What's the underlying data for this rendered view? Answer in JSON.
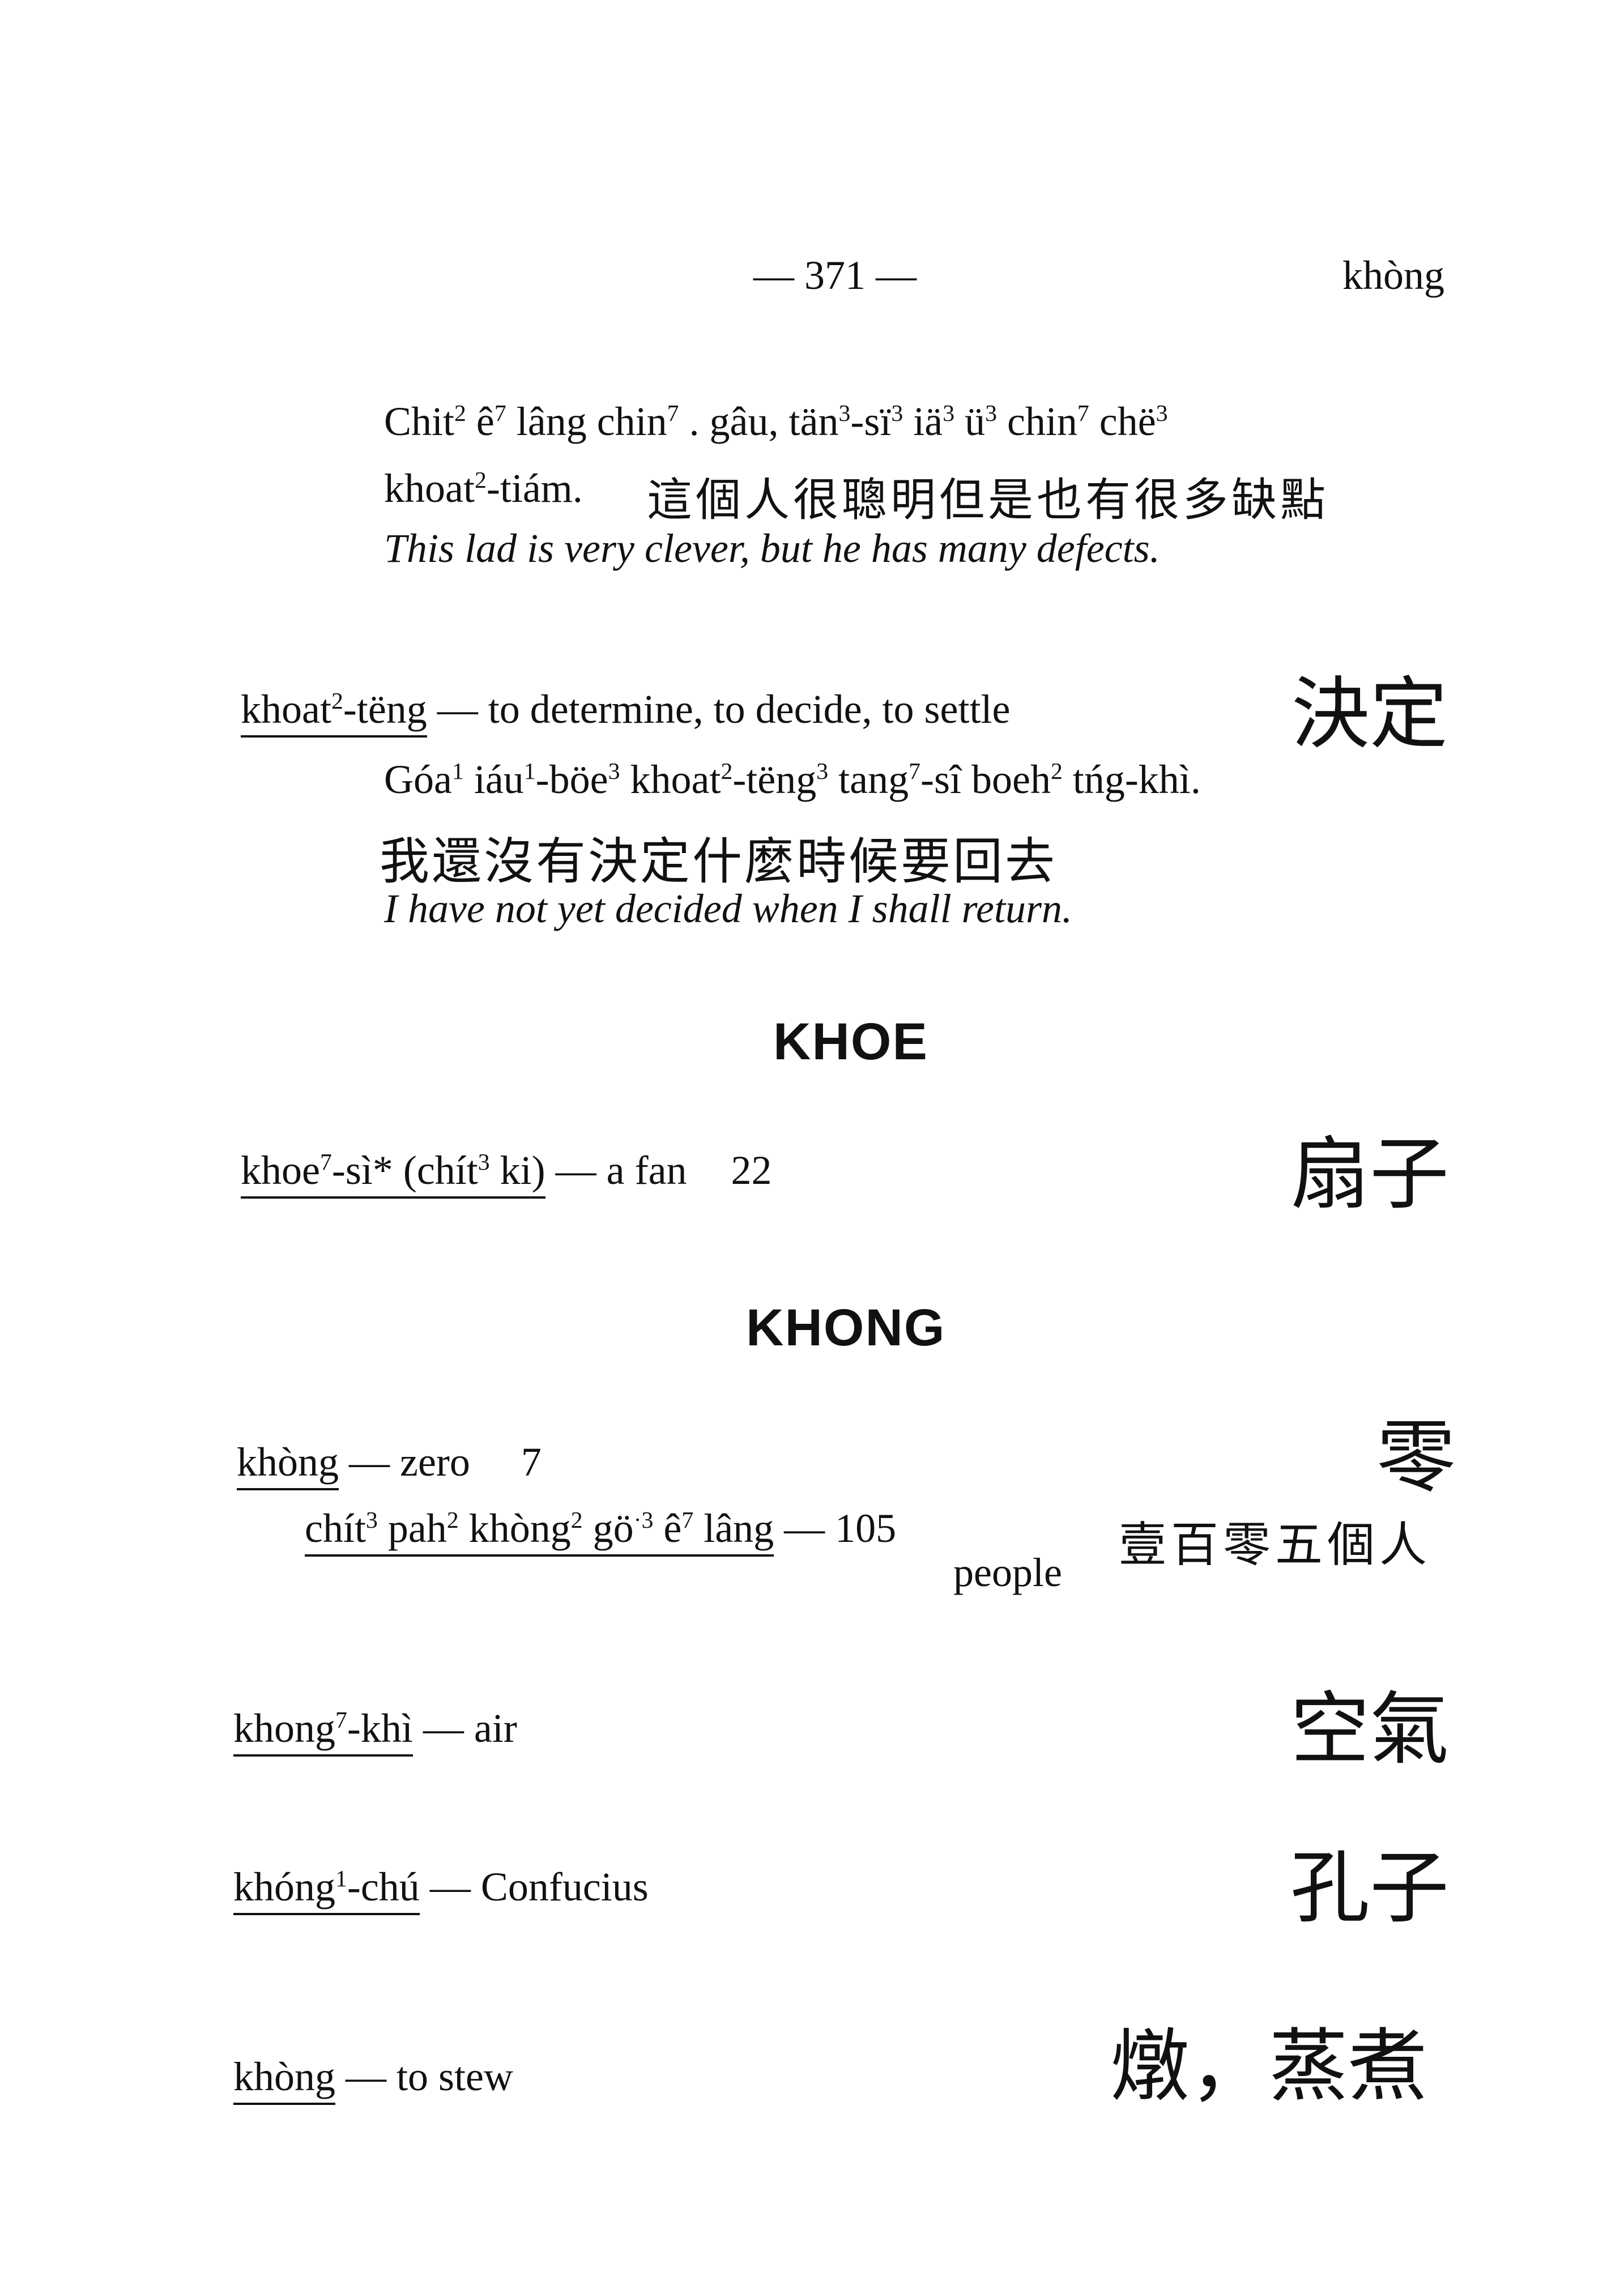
{
  "header": {
    "page_number": "— 371 —",
    "running_head": "khòng"
  },
  "example_top": {
    "line1": [
      {
        "t": "Chit"
      },
      {
        "s": "2"
      },
      {
        "t": " ê"
      },
      {
        "s": "7"
      },
      {
        "t": " lâng chin"
      },
      {
        "s": "7"
      },
      {
        "t": " . gâu, tän"
      },
      {
        "s": "3"
      },
      {
        "t": "-sï"
      },
      {
        "s": "3"
      },
      {
        "t": " iä"
      },
      {
        "s": "3"
      },
      {
        "t": " ü"
      },
      {
        "s": "3"
      },
      {
        "t": " chin"
      },
      {
        "s": "7"
      },
      {
        "t": " chë"
      },
      {
        "s": "3"
      }
    ],
    "line2": [
      {
        "t": "khoat"
      },
      {
        "s": "2"
      },
      {
        "t": "-tiám."
      }
    ],
    "line2_hanzi": "這個人很聰明但是也有很多缺點",
    "translation": "This lad is very clever, but he has many defects."
  },
  "entry_khoat_teng": {
    "headword": [
      {
        "t": "khoat"
      },
      {
        "s": "2"
      },
      {
        "t": "-tëng"
      }
    ],
    "gloss": " — to determine, to decide, to settle",
    "hanzi": "決定",
    "example_roman": [
      {
        "t": "Góa"
      },
      {
        "s": "1"
      },
      {
        "t": " iáu"
      },
      {
        "s": "1"
      },
      {
        "t": "-böe"
      },
      {
        "s": "3"
      },
      {
        "t": " khoat"
      },
      {
        "s": "2"
      },
      {
        "t": "-tëng"
      },
      {
        "s": "3"
      },
      {
        "t": " tang"
      },
      {
        "s": "7"
      },
      {
        "t": "-sî boeh"
      },
      {
        "s": "2"
      },
      {
        "t": " tńg-khì."
      }
    ],
    "example_hanzi": "我還沒有決定什麼時候要回去",
    "translation": "I have not yet decided when I shall return."
  },
  "section_khoe": {
    "title": "KHOE"
  },
  "entry_khoe_si": {
    "headword": [
      {
        "t": "khoe"
      },
      {
        "s": "7"
      },
      {
        "t": "-sì* (chít"
      },
      {
        "s": "3"
      },
      {
        "t": " ki)"
      }
    ],
    "gloss": " — a fan",
    "ref": "22",
    "hanzi": "扇子"
  },
  "section_khong": {
    "title": "KHONG"
  },
  "entry_khong_zero": {
    "headword": [
      {
        "t": "khòng"
      }
    ],
    "gloss": " — zero",
    "ref": "7",
    "hanzi": "零",
    "sub_roman": [
      {
        "t": "chít"
      },
      {
        "s": "3"
      },
      {
        "t": " pah"
      },
      {
        "s": "2"
      },
      {
        "t": " khòng"
      },
      {
        "s": "2"
      },
      {
        "t": " gö"
      },
      {
        "s": "·3"
      },
      {
        "t": " ê"
      },
      {
        "s": "7"
      },
      {
        "t": " lâng"
      }
    ],
    "sub_gloss": " — 105",
    "sub_gloss_line2": "people",
    "sub_hanzi": "壹百零五個人"
  },
  "entry_khong_khi": {
    "headword": [
      {
        "t": "khong"
      },
      {
        "s": "7"
      },
      {
        "t": "-khì"
      }
    ],
    "gloss": " — air",
    "hanzi": "空氣"
  },
  "entry_khong_chu": {
    "headword": [
      {
        "t": "khóng"
      },
      {
        "s": "1"
      },
      {
        "t": "-chú"
      }
    ],
    "gloss": " — Confucius",
    "hanzi": "孔子"
  },
  "entry_khong_stew": {
    "headword": [
      {
        "t": "khòng"
      }
    ],
    "gloss": " — to stew",
    "hanzi": "燉，蒸煮"
  }
}
